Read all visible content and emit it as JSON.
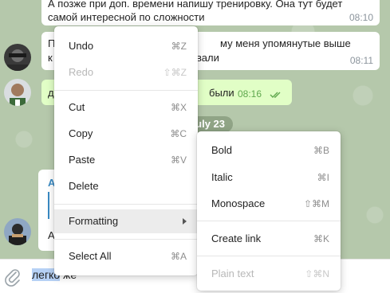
{
  "messages": [
    {
      "text_line1": "А позже при доп. времени напишу тренировку. Она тут будет",
      "text_line2": "самой интересной по сложности",
      "time": "08:10"
    },
    {
      "text_line1_visible": "П",
      "text_line1_right": "му меня упомянутые выше",
      "text_line2_visible": "к",
      "text_line2_right": "вали",
      "time": "08:11"
    },
    {
      "text_left": "д",
      "text_right": "были",
      "time": "08:16",
      "status": "read"
    },
    {
      "name_fragment": "А",
      "text_fragment": "А"
    }
  ],
  "date_separator": "uly 23",
  "composer": {
    "text_selected": "легко",
    "text_rest": " же"
  },
  "context_menu": {
    "items": [
      {
        "label": "Undo",
        "shortcut": "⌘Z"
      },
      {
        "label": "Redo",
        "shortcut": "⇧⌘Z",
        "disabled": true
      },
      {
        "label": "Cut",
        "shortcut": "⌘X"
      },
      {
        "label": "Copy",
        "shortcut": "⌘C"
      },
      {
        "label": "Paste",
        "shortcut": "⌘V"
      },
      {
        "label": "Delete",
        "shortcut": ""
      },
      {
        "label": "Formatting",
        "shortcut": "",
        "submenu": true
      },
      {
        "label": "Select All",
        "shortcut": "⌘A"
      }
    ]
  },
  "formatting_menu": {
    "items": [
      {
        "label": "Bold",
        "shortcut": "⌘B"
      },
      {
        "label": "Italic",
        "shortcut": "⌘I"
      },
      {
        "label": "Monospace",
        "shortcut": "⇧⌘M"
      },
      {
        "label": "Create link",
        "shortcut": "⌘K"
      },
      {
        "label": "Plain text",
        "shortcut": "⇧⌘N",
        "disabled": true
      }
    ]
  }
}
